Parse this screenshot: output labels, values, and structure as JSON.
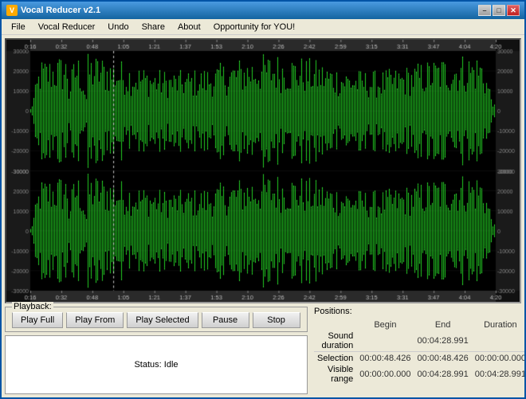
{
  "window": {
    "title": "Vocal Reducer v2.1",
    "icon": "V"
  },
  "menu": {
    "items": [
      "File",
      "Vocal Reducer",
      "Undo",
      "Share",
      "About",
      "Opportunity for YOU!"
    ]
  },
  "timeline": {
    "labels": [
      "0:16",
      "0:32",
      "0:48",
      "1:05",
      "1:21",
      "1:37",
      "1:53",
      "2:10",
      "2:26",
      "2:42",
      "2:59",
      "3:15",
      "3:31",
      "3:47",
      "4:04",
      "4:20"
    ]
  },
  "y_axis": {
    "top_labels": [
      "30000",
      "20000",
      "10000",
      "0",
      "-10000",
      "-20000",
      "-30000"
    ],
    "bottom_labels": [
      "30000",
      "20000",
      "10000",
      "0",
      "-10000",
      "-20000",
      "-30000"
    ]
  },
  "playback": {
    "group_label": "Playback:",
    "buttons": {
      "play_full": "Play Full",
      "play_from": "Play From",
      "play_selected": "Play Selected",
      "pause": "Pause",
      "stop": "Stop"
    },
    "status": "Status: Idle"
  },
  "positions": {
    "label": "Positions:",
    "sound_duration_label": "Sound duration",
    "sound_duration_value": "00:04:28.991",
    "headers": [
      "",
      "Begin",
      "End",
      "Duration"
    ],
    "rows": [
      {
        "label": "Selection",
        "begin": "00:00:48.426",
        "end": "00:00:48.426",
        "duration": "00:00:00.000"
      },
      {
        "label": "Visible range",
        "begin": "00:00:00.000",
        "end": "00:04:28.991",
        "duration": "00:04:28.991"
      }
    ]
  },
  "colors": {
    "waveform_green": "#22cc22",
    "waveform_dark_green": "#117711",
    "background": "#111111",
    "accent": "#1464a0"
  }
}
